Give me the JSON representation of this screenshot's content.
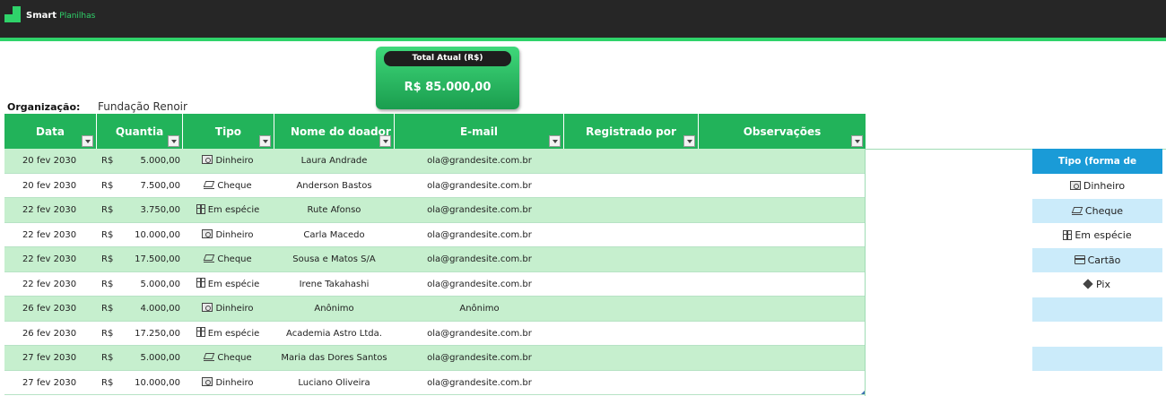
{
  "brand": {
    "name_bold": "Smart",
    "name_light": "Planilhas"
  },
  "total": {
    "label": "Total Atual (R$)",
    "value": "R$ 85.000,00"
  },
  "organization": {
    "label": "Organização:",
    "value": "Fundação Renoir"
  },
  "columns": [
    "Data",
    "Quantia",
    "Tipo",
    "Nome do doador",
    "E-mail",
    "Registrado por",
    "Observações"
  ],
  "rows": [
    {
      "date": "20 fev 2030",
      "currency": "R$",
      "amount": "5.000,00",
      "tipo": "Dinheiro",
      "icon": "bill-icon",
      "nome": "Laura Andrade",
      "email": "ola@grandesite.com.br"
    },
    {
      "date": "20 fev 2030",
      "currency": "R$",
      "amount": "7.500,00",
      "tipo": "Cheque",
      "icon": "check-icon",
      "nome": "Anderson Bastos",
      "email": "ola@grandesite.com.br"
    },
    {
      "date": "22 fev 2030",
      "currency": "R$",
      "amount": "3.750,00",
      "tipo": "Em espécie",
      "icon": "gift-icon",
      "nome": "Rute Afonso",
      "email": "ola@grandesite.com.br"
    },
    {
      "date": "22 fev 2030",
      "currency": "R$",
      "amount": "10.000,00",
      "tipo": "Dinheiro",
      "icon": "bill-icon",
      "nome": "Carla Macedo",
      "email": "ola@grandesite.com.br"
    },
    {
      "date": "22 fev 2030",
      "currency": "R$",
      "amount": "17.500,00",
      "tipo": "Cheque",
      "icon": "check-icon",
      "nome": "Sousa e Matos S/A",
      "email": "ola@grandesite.com.br"
    },
    {
      "date": "22 fev 2030",
      "currency": "R$",
      "amount": "5.000,00",
      "tipo": "Em espécie",
      "icon": "gift-icon",
      "nome": "Irene Takahashi",
      "email": "ola@grandesite.com.br"
    },
    {
      "date": "26 fev 2030",
      "currency": "R$",
      "amount": "4.000,00",
      "tipo": "Dinheiro",
      "icon": "bill-icon",
      "nome": "Anônimo",
      "email": "Anônimo"
    },
    {
      "date": "26 fev 2030",
      "currency": "R$",
      "amount": "17.250,00",
      "tipo": "Em espécie",
      "icon": "gift-icon",
      "nome": "Academia Astro Ltda.",
      "email": "ola@grandesite.com.br"
    },
    {
      "date": "27 fev 2030",
      "currency": "R$",
      "amount": "5.000,00",
      "tipo": "Cheque",
      "icon": "check-icon",
      "nome": "Maria das Dores Santos",
      "email": "ola@grandesite.com.br"
    },
    {
      "date": "27 fev 2030",
      "currency": "R$",
      "amount": "10.000,00",
      "tipo": "Dinheiro",
      "icon": "bill-icon",
      "nome": "Luciano Oliveira",
      "email": "ola@grandesite.com.br"
    }
  ],
  "payment_types": {
    "header": "Tipo (forma de pagamento)",
    "items": [
      {
        "label": "Dinheiro",
        "icon": "bill-icon"
      },
      {
        "label": "Cheque",
        "icon": "check-icon"
      },
      {
        "label": "Em espécie",
        "icon": "gift-icon"
      },
      {
        "label": "Cartão",
        "icon": "card-icon"
      },
      {
        "label": "Pix",
        "icon": "pix-icon"
      },
      {
        "label": "",
        "icon": ""
      },
      {
        "label": "",
        "icon": ""
      },
      {
        "label": "",
        "icon": ""
      }
    ]
  },
  "colors": {
    "brand_green": "#2fd36a",
    "header_green": "#22b35a",
    "band_green": "#c6efce",
    "side_blue": "#1a9bd7",
    "side_band": "#cbebfa"
  }
}
